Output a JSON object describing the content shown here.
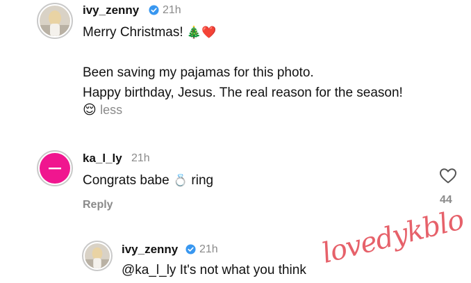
{
  "comment1": {
    "username": "ivy_zenny",
    "time": "21h",
    "line1": "Merry Christmas!",
    "line1_emoji": "🎄❤️",
    "line2": "Been saving my pajamas for this photo.",
    "line3": "Happy birthday, Jesus. The real reason for the season!",
    "emoji_end": "😌",
    "less_label": "less"
  },
  "comment2": {
    "username": "ka_l_ly",
    "time": "21h",
    "text_before": "Congrats babe",
    "emoji": "💍",
    "text_after": "ring",
    "reply_label": "Reply",
    "like_count": "44"
  },
  "reply": {
    "username": "ivy_zenny",
    "time": "21h",
    "mention": "@ka_l_ly",
    "text": "It's not what you think"
  },
  "watermark_text": "lovedykblo",
  "colors": {
    "verified": "#3897f0",
    "avatar_pink": "#f0168f",
    "watermark": "#e4505a"
  }
}
